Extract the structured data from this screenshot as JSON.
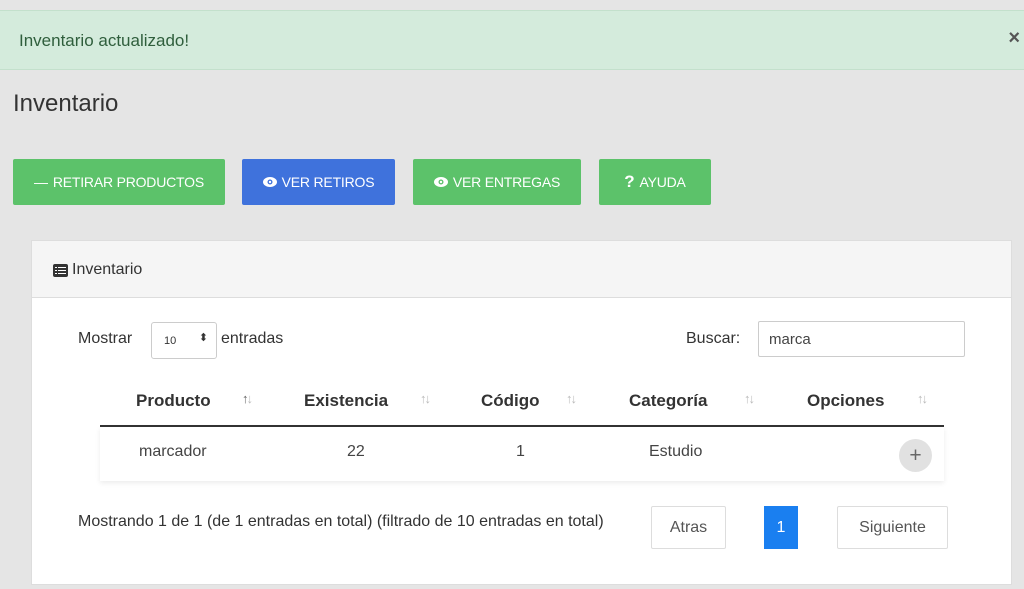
{
  "alert": {
    "message": "Inventario actualizado!",
    "close_symbol": "×"
  },
  "page": {
    "title": "Inventario"
  },
  "toolbar": {
    "retirar_label": "RETIRAR PRODUCTOS",
    "retirar_icon": "—",
    "ver_retiros_label": "VER RETIROS",
    "ver_entregas_label": "VER ENTREGAS",
    "ayuda_label": "AYUDA",
    "ayuda_icon": "?",
    "green_color": "#5cc26a",
    "blue_color": "#3f72dc"
  },
  "panel": {
    "title": "Inventario"
  },
  "table_controls": {
    "show_label": "Mostrar",
    "page_size": "10",
    "page_size_caret": "⬍",
    "entries_label": "entradas",
    "search_label": "Buscar:",
    "search_value": "marca"
  },
  "table": {
    "columns": [
      "Producto",
      "Existencia",
      "Código",
      "Categoría",
      "Opciones"
    ],
    "rows": [
      {
        "producto": "marcador",
        "existencia": "22",
        "codigo": "1",
        "categoria": "Estudio"
      }
    ]
  },
  "footer": {
    "info": "Mostrando 1 de 1 (de 1 entradas en total) (filtrado de 10 entradas en total)",
    "prev_label": "Atras",
    "current_page": "1",
    "next_label": "Siguiente",
    "active_color": "#1a7ff0"
  }
}
